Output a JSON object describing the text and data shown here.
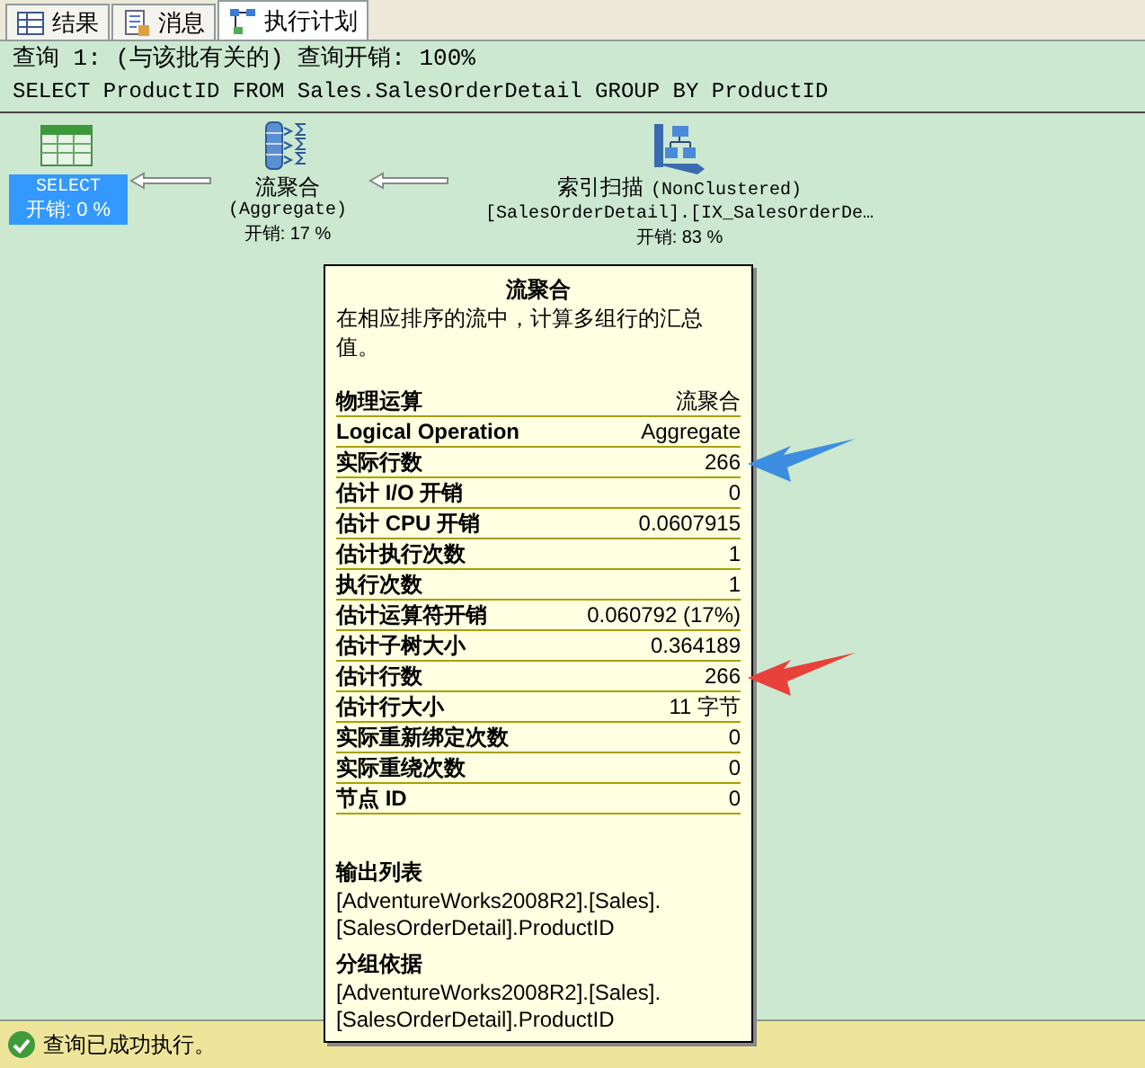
{
  "tabs": [
    {
      "label": "结果",
      "kind": "grid",
      "selected": false
    },
    {
      "label": "消息",
      "kind": "messages",
      "selected": false
    },
    {
      "label": "执行计划",
      "kind": "plan",
      "selected": true
    }
  ],
  "query": {
    "header": "查询 1: (与该批有关的) 查询开销: 100%",
    "sql": "SELECT ProductID FROM Sales.SalesOrderDetail GROUP BY ProductID"
  },
  "nodes": [
    {
      "kind": "select",
      "name": "SELECT",
      "cost": "开销: 0 %",
      "selected": true
    },
    {
      "kind": "aggregate",
      "name": "流聚合",
      "subtitle": "(Aggregate)",
      "cost": "开销: 17 %",
      "selected": false
    },
    {
      "kind": "index_scan",
      "name": "索引扫描",
      "subtitle": "(NonClustered)",
      "object": "[SalesOrderDetail].[IX_SalesOrderDe…",
      "cost": "开销: 83 %",
      "selected": false
    }
  ],
  "tooltip": {
    "title": "流聚合",
    "description": "在相应排序的流中，计算多组行的汇总值。",
    "properties": [
      {
        "label": "物理运算",
        "value": "流聚合"
      },
      {
        "label": "Logical Operation",
        "value": "Aggregate"
      },
      {
        "label": "实际行数",
        "value": "266",
        "color": "#3d8ee0"
      },
      {
        "label": "估计 I/O 开销",
        "value": "0"
      },
      {
        "label": "估计 CPU 开销",
        "value": "0.0607915"
      },
      {
        "label": "估计执行次数",
        "value": "1"
      },
      {
        "label": "执行次数",
        "value": "1"
      },
      {
        "label": "估计运算符开销",
        "value": "0.060792 (17%)"
      },
      {
        "label": "估计子树大小",
        "value": "0.364189"
      },
      {
        "label": "估计行数",
        "value": "266",
        "color": "#e8403a"
      },
      {
        "label": "估计行大小",
        "value": "11 字节"
      },
      {
        "label": "实际重新绑定次数",
        "value": "0"
      },
      {
        "label": "实际重绕次数",
        "value": "0"
      },
      {
        "label": "节点 ID",
        "value": "0"
      }
    ],
    "sections": [
      {
        "heading": "输出列表",
        "lines": [
          "[AdventureWorks2008R2].[Sales].",
          "[SalesOrderDetail].ProductID"
        ]
      },
      {
        "heading": "分组依据",
        "lines": [
          "[AdventureWorks2008R2].[Sales].",
          "[SalesOrderDetail].ProductID"
        ]
      }
    ]
  },
  "status_bar": {
    "message": "查询已成功执行。"
  }
}
